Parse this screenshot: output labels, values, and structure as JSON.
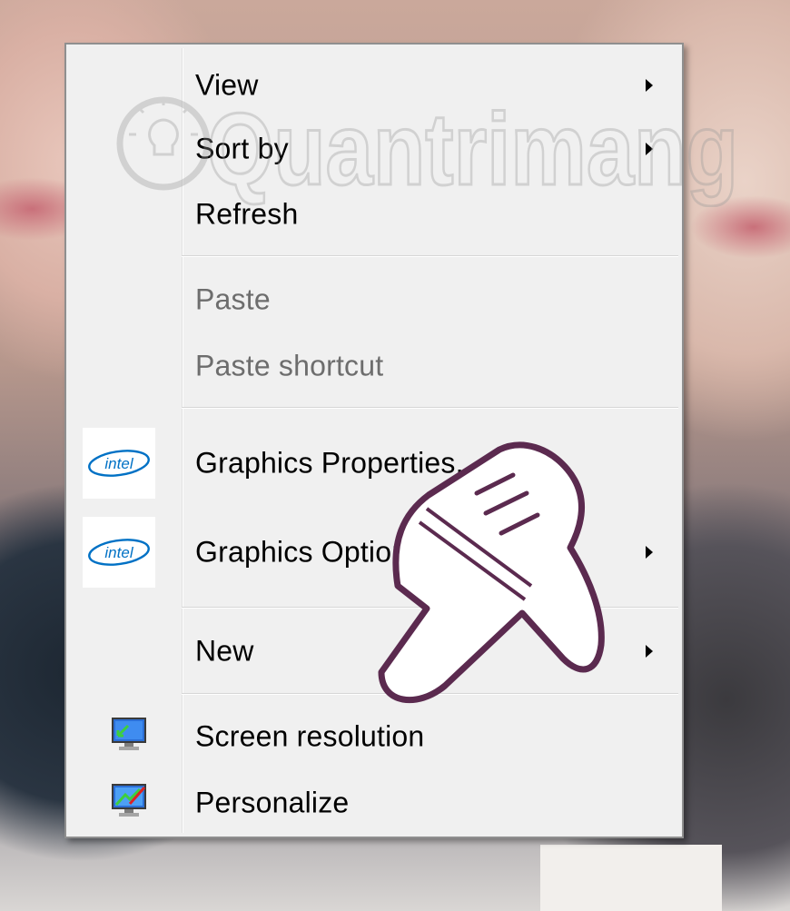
{
  "watermark": {
    "text": "Quantrimang"
  },
  "context_menu": {
    "items": [
      {
        "label": "View",
        "submenu": true,
        "enabled": true
      },
      {
        "label": "Sort by",
        "submenu": true,
        "enabled": true
      },
      {
        "label": "Refresh",
        "submenu": false,
        "enabled": true
      },
      {
        "label": "Paste",
        "submenu": false,
        "enabled": false
      },
      {
        "label": "Paste shortcut",
        "submenu": false,
        "enabled": false
      },
      {
        "label": "Graphics Properties...",
        "icon": "intel-logo-icon",
        "submenu": false,
        "enabled": true
      },
      {
        "label": "Graphics Options",
        "icon": "intel-logo-icon",
        "submenu": true,
        "enabled": true
      },
      {
        "label": "New",
        "submenu": true,
        "enabled": true
      },
      {
        "label": "Screen resolution",
        "icon": "screen-resolution-monitor-icon",
        "submenu": false,
        "enabled": true
      },
      {
        "label": "Personalize",
        "icon": "personalize-monitor-icon",
        "submenu": false,
        "enabled": true
      }
    ]
  },
  "icons": {
    "intel_logo_text": "intel",
    "intel_blue": "#0071c5",
    "pointer": "hand-pointer-icon"
  },
  "colors": {
    "menu_background": "#f0f0f0",
    "menu_border": "#8f8f8f",
    "disabled_text": "#6d6d6d",
    "hand_outline": "#5b2a4f"
  }
}
